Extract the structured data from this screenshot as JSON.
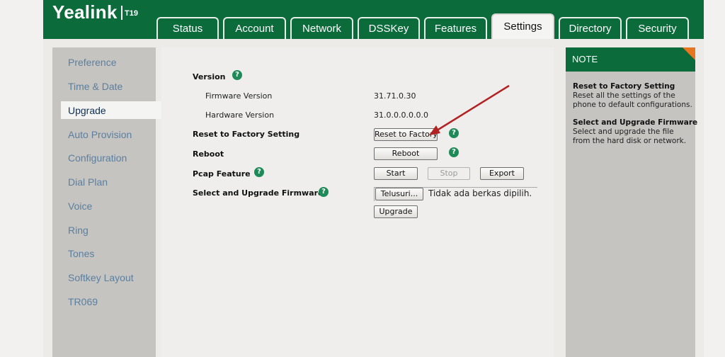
{
  "brand": {
    "name": "Yealink",
    "model": "T19"
  },
  "tabs": [
    {
      "label": "Status"
    },
    {
      "label": "Account"
    },
    {
      "label": "Network"
    },
    {
      "label": "DSSKey"
    },
    {
      "label": "Features"
    },
    {
      "label": "Settings"
    },
    {
      "label": "Directory"
    },
    {
      "label": "Security"
    }
  ],
  "sidebar": {
    "items": [
      {
        "label": "Preference"
      },
      {
        "label": "Time & Date"
      },
      {
        "label": "Upgrade"
      },
      {
        "label": "Auto Provision"
      },
      {
        "label": "Configuration"
      },
      {
        "label": "Dial Plan"
      },
      {
        "label": "Voice"
      },
      {
        "label": "Ring"
      },
      {
        "label": "Tones"
      },
      {
        "label": "Softkey Layout"
      },
      {
        "label": "TR069"
      }
    ]
  },
  "main": {
    "version": {
      "label": "Version",
      "firmware_label": "Firmware Version",
      "firmware_value": "31.71.0.30",
      "hardware_label": "Hardware Version",
      "hardware_value": "31.0.0.0.0.0.0"
    },
    "reset": {
      "label": "Reset to Factory Setting",
      "button": "Reset to Factory"
    },
    "reboot": {
      "label": "Reboot",
      "button": "Reboot"
    },
    "pcap": {
      "label": "Pcap Feature",
      "start": "Start",
      "stop": "Stop",
      "export": "Export"
    },
    "firmware": {
      "label": "Select and Upgrade Firmware",
      "browse": "Telusuri...",
      "no_file": "Tidak ada berkas dipilih.",
      "upgrade": "Upgrade"
    },
    "help_glyph": "?"
  },
  "note": {
    "title": "NOTE",
    "items": [
      {
        "title": "Reset to Factory Setting",
        "desc": "Reset all the settings of the phone to default configurations."
      },
      {
        "title": "Select and Upgrade Firmware",
        "desc": "Select and upgrade the file from the hard disk or network."
      }
    ]
  },
  "colors": {
    "brand_green": "#0b6b3a",
    "note_corner": "#e8751f",
    "help_icon": "#1d8a58",
    "annotation_arrow": "#b22222"
  }
}
